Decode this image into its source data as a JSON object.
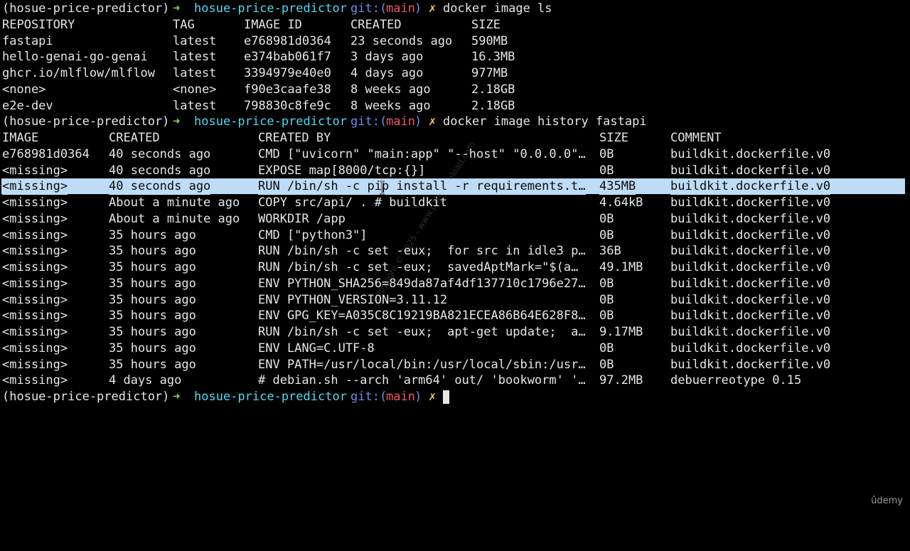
{
  "prompt": {
    "env": "(hosue-price-predictor)",
    "arrow": "➜",
    "dir": "hosue-price-predictor",
    "git_prefix": "git:(",
    "branch": "main",
    "git_suffix": ")",
    "dirty": "✗"
  },
  "commands": {
    "first": "docker image ls",
    "second": "docker image history fastapi"
  },
  "image_ls": {
    "headers": [
      "REPOSITORY",
      "TAG",
      "IMAGE ID",
      "CREATED",
      "SIZE"
    ],
    "rows": [
      [
        "fastapi",
        "latest",
        "e768981d0364",
        "23 seconds ago",
        "590MB"
      ],
      [
        "hello-genai-go-genai",
        "latest",
        "e374bab061f7",
        "3 days ago",
        "16.3MB"
      ],
      [
        "ghcr.io/mlflow/mlflow",
        "latest",
        "3394979e40e0",
        "4 days ago",
        "977MB"
      ],
      [
        "<none>",
        "<none>",
        "f90e3caafe38",
        "8 weeks ago",
        "2.18GB"
      ],
      [
        "e2e-dev",
        "latest",
        "798830c8fe9c",
        "8 weeks ago",
        "2.18GB"
      ]
    ]
  },
  "history": {
    "headers": [
      "IMAGE",
      "CREATED",
      "CREATED BY",
      "SIZE",
      "COMMENT"
    ],
    "rows": [
      [
        "e768981d0364",
        "40 seconds ago",
        "CMD [\"uvicorn\" \"main:app\" \"--host\" \"0.0.0.0\"…",
        "0B",
        "buildkit.dockerfile.v0"
      ],
      [
        "<missing>",
        "40 seconds ago",
        "EXPOSE map[8000/tcp:{}]",
        "0B",
        "buildkit.dockerfile.v0"
      ],
      [
        "<missing>",
        "40 seconds ago",
        "RUN /bin/sh -c pip install -r requirements.t…",
        "435MB",
        "buildkit.dockerfile.v0"
      ],
      [
        "<missing>",
        "About a minute ago",
        "COPY src/api/ . # buildkit",
        "4.64kB",
        "buildkit.dockerfile.v0"
      ],
      [
        "<missing>",
        "About a minute ago",
        "WORKDIR /app",
        "0B",
        "buildkit.dockerfile.v0"
      ],
      [
        "<missing>",
        "35 hours ago",
        "CMD [\"python3\"]",
        "0B",
        "buildkit.dockerfile.v0"
      ],
      [
        "<missing>",
        "35 hours ago",
        "RUN /bin/sh -c set -eux;  for src in idle3 p…",
        "36B",
        "buildkit.dockerfile.v0"
      ],
      [
        "<missing>",
        "35 hours ago",
        "RUN /bin/sh -c set -eux;  savedAptMark=\"$(a…",
        "49.1MB",
        "buildkit.dockerfile.v0"
      ],
      [
        "<missing>",
        "35 hours ago",
        "ENV PYTHON_SHA256=849da87af4df137710c1796e27…",
        "0B",
        "buildkit.dockerfile.v0"
      ],
      [
        "<missing>",
        "35 hours ago",
        "ENV PYTHON_VERSION=3.11.12",
        "0B",
        "buildkit.dockerfile.v0"
      ],
      [
        "<missing>",
        "35 hours ago",
        "ENV GPG_KEY=A035C8C19219BA821ECEA86B64E628F8…",
        "0B",
        "buildkit.dockerfile.v0"
      ],
      [
        "<missing>",
        "35 hours ago",
        "RUN /bin/sh -c set -eux;  apt-get update;  a…",
        "9.17MB",
        "buildkit.dockerfile.v0"
      ],
      [
        "<missing>",
        "35 hours ago",
        "ENV LANG=C.UTF-8",
        "0B",
        "buildkit.dockerfile.v0"
      ],
      [
        "<missing>",
        "35 hours ago",
        "ENV PATH=/usr/local/bin:/usr/local/sbin:/usr…",
        "0B",
        "buildkit.dockerfile.v0"
      ],
      [
        "<missing>",
        "4 days ago",
        "# debian.sh --arch 'arm64' out/ 'bookworm' '…",
        "97.2MB",
        "debuerreotype 0.15"
      ]
    ],
    "highlighted_row": 2
  },
  "watermark": "Copyright © 2025 - www.p30download.com",
  "brand": "ûdemy"
}
